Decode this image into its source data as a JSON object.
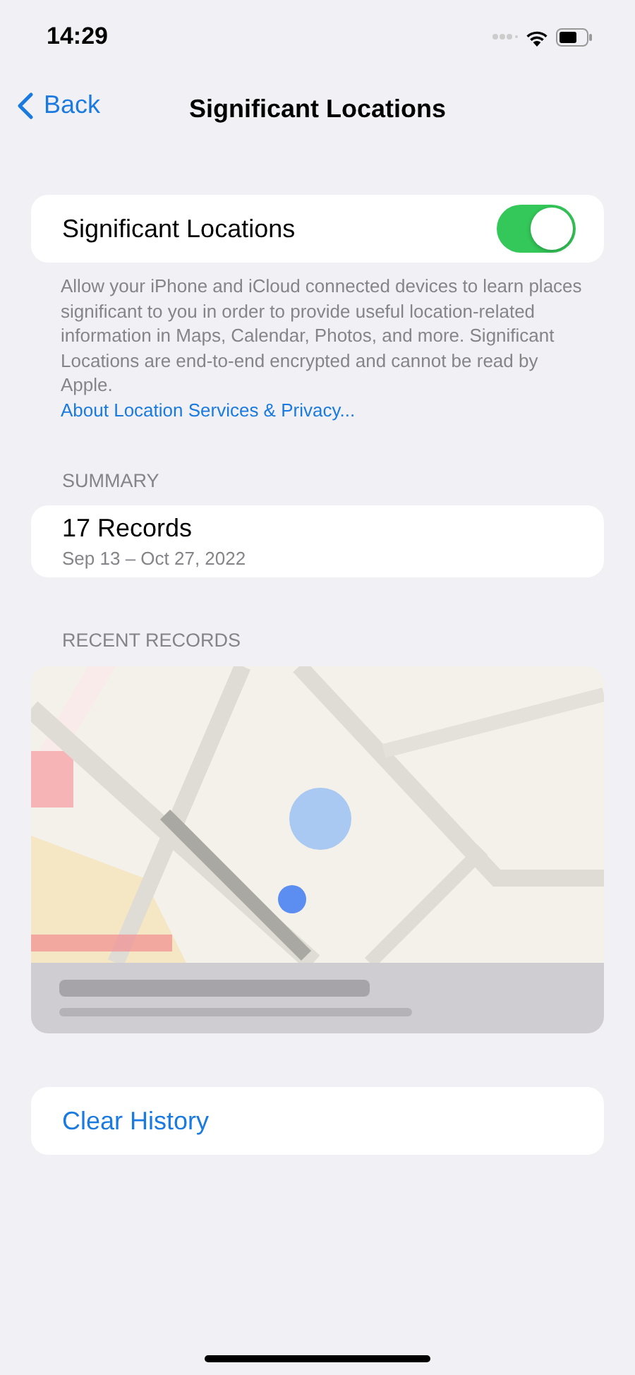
{
  "status_bar": {
    "time": "14:29"
  },
  "nav": {
    "back": "Back",
    "title": "Significant Locations"
  },
  "toggle": {
    "label": "Significant Locations",
    "on": true
  },
  "footer": {
    "text": "Allow your iPhone and iCloud connected devices to learn places significant to you in order to provide useful location-related information in Maps, Calendar, Photos, and more. Significant Locations are end-to-end encrypted and cannot be read by Apple.",
    "link": "About Location Services & Privacy..."
  },
  "summary": {
    "header": "SUMMARY",
    "title": "17 Records",
    "dates": "Sep 13 – Oct 27, 2022"
  },
  "recent": {
    "header": "RECENT RECORDS",
    "kind": "picture"
  },
  "clear_button": "Clear History"
}
